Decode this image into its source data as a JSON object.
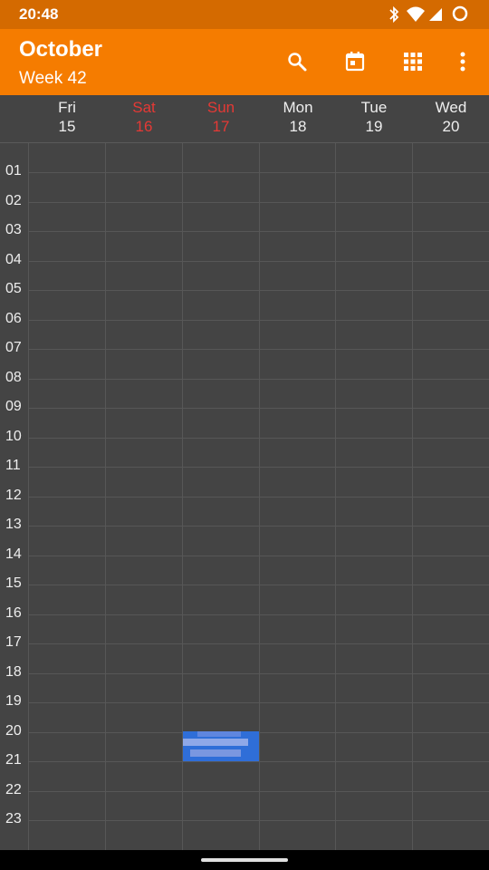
{
  "status_bar": {
    "time": "20:48",
    "icons": [
      "bluetooth-icon",
      "wifi-icon",
      "cell-signal-icon",
      "battery-ring-icon"
    ]
  },
  "app_bar": {
    "title": "October",
    "subtitle": "Week 42",
    "actions": [
      "search-icon",
      "calendar-today-icon",
      "grid-view-icon",
      "more-vert-icon"
    ],
    "color": "#f57c00"
  },
  "days": [
    {
      "name": "Fri",
      "num": "15",
      "weekend": false
    },
    {
      "name": "Sat",
      "num": "16",
      "weekend": true
    },
    {
      "name": "Sun",
      "num": "17",
      "weekend": true
    },
    {
      "name": "Mon",
      "num": "18",
      "weekend": false
    },
    {
      "name": "Tue",
      "num": "19",
      "weekend": false
    },
    {
      "name": "Wed",
      "num": "20",
      "weekend": false
    }
  ],
  "hours": [
    "01",
    "02",
    "03",
    "04",
    "05",
    "06",
    "07",
    "08",
    "09",
    "10",
    "11",
    "12",
    "13",
    "14",
    "15",
    "16",
    "17",
    "18",
    "19",
    "20",
    "21",
    "22",
    "23"
  ],
  "event": {
    "day": "Sun 17",
    "start_hour": "20",
    "end_hour": "21",
    "color": "#2f6ed8"
  },
  "colors": {
    "weekend": "#e53935",
    "background": "#444444"
  }
}
